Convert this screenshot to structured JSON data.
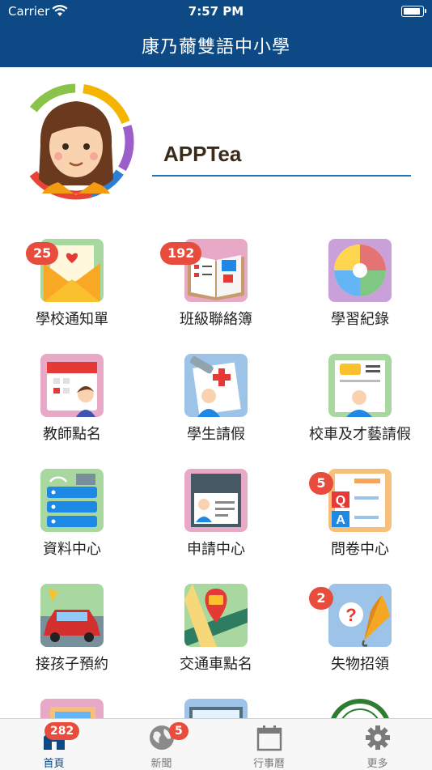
{
  "status_bar": {
    "carrier": "Carrier",
    "time": "7:57 PM"
  },
  "header": {
    "title": "康乃薾雙語中小學"
  },
  "profile": {
    "name": "APPTea"
  },
  "grid": {
    "items": [
      {
        "label": "學校通知單",
        "badge": "25",
        "icon": "notice-envelope-icon"
      },
      {
        "label": "班級聯絡簿",
        "badge": "192",
        "icon": "contact-book-icon"
      },
      {
        "label": "學習紀錄",
        "badge": "",
        "icon": "learning-record-icon"
      },
      {
        "label": "教師點名",
        "badge": "",
        "icon": "teacher-attendance-icon"
      },
      {
        "label": "學生請假",
        "badge": "",
        "icon": "student-leave-icon"
      },
      {
        "label": "校車及才藝請假",
        "badge": "",
        "icon": "school-bus-leave-icon"
      },
      {
        "label": "資料中心",
        "badge": "",
        "icon": "data-center-icon"
      },
      {
        "label": "申請中心",
        "badge": "",
        "icon": "application-center-icon"
      },
      {
        "label": "問卷中心",
        "badge": "5",
        "icon": "questionnaire-icon"
      },
      {
        "label": "接孩子預約",
        "badge": "",
        "icon": "pickup-car-icon"
      },
      {
        "label": "交通車點名",
        "badge": "",
        "icon": "bus-roll-call-icon"
      },
      {
        "label": "失物招領",
        "badge": "2",
        "icon": "lost-and-found-icon"
      }
    ]
  },
  "tabbar": {
    "tabs": [
      {
        "label": "首頁",
        "badge": "282",
        "icon": "home-icon"
      },
      {
        "label": "新聞",
        "badge": "5",
        "icon": "globe-icon"
      },
      {
        "label": "行事曆",
        "badge": "",
        "icon": "calendar-icon"
      },
      {
        "label": "更多",
        "badge": "",
        "icon": "gear-icon"
      }
    ]
  },
  "colors": {
    "header_bg": "#0d4a85",
    "badge": "#e74c3c",
    "underline": "#1f78b4",
    "active_tab": "#0d4a85"
  }
}
